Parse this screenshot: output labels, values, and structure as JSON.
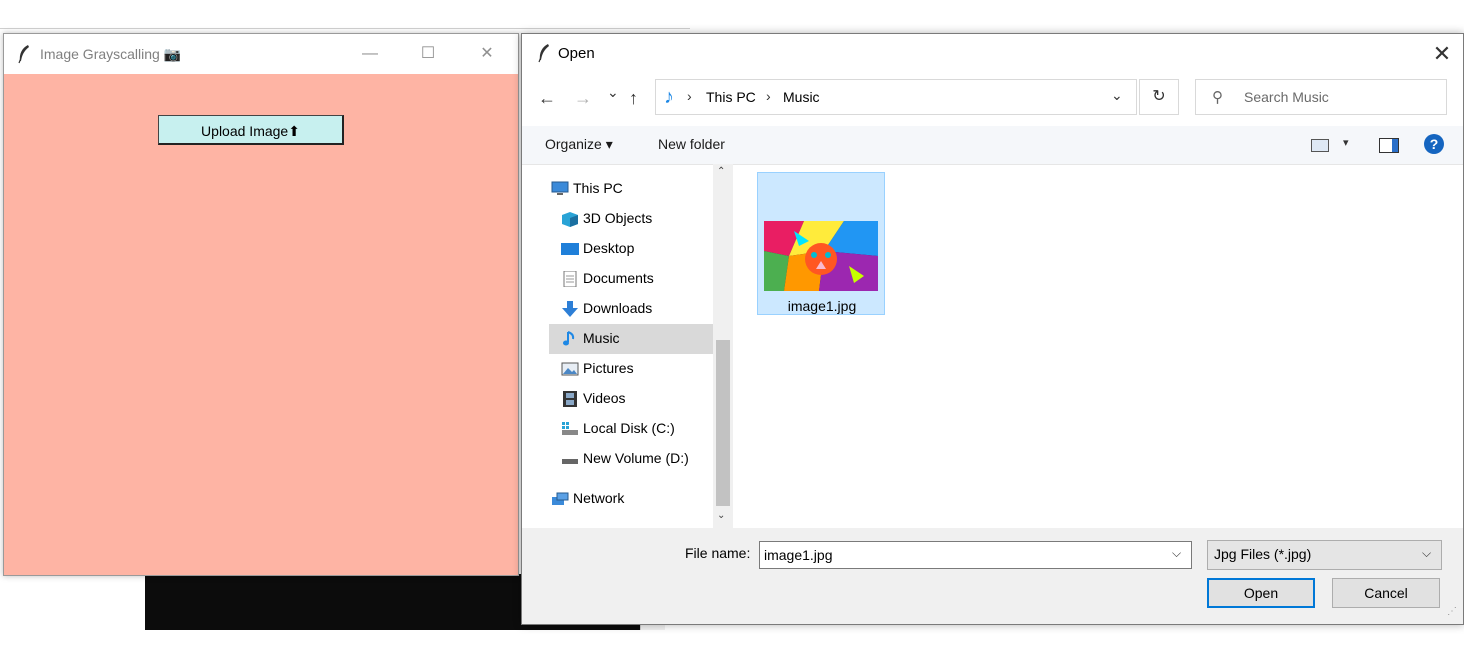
{
  "tk_window": {
    "title": "Image Grayscalling 📷",
    "icon": "tk-feather-icon",
    "controls": {
      "minimize": "—",
      "maximize": "☐",
      "close": "✕"
    },
    "upload_button": "Upload Image⬆",
    "background_color": "#feb4a4",
    "button_color": "#c7f0ef"
  },
  "dialog": {
    "title": "Open",
    "close": "✕",
    "nav": {
      "back": "←",
      "forward": "→",
      "recent": "⌄",
      "up": "↑"
    },
    "breadcrumb": [
      "This PC",
      "Music"
    ],
    "breadcrumb_sep": "›",
    "address_dropdown": "⌄",
    "refresh": "↻",
    "search": {
      "placeholder": "Search Music",
      "icon": "search-icon"
    },
    "toolbar": {
      "organize": "Organize ▾",
      "new_folder": "New folder",
      "view_dropdown": "▾",
      "help": "?"
    },
    "nav_pane": [
      {
        "label": "This PC",
        "icon": "computer-icon"
      },
      {
        "label": "3D Objects",
        "icon": "cube-icon"
      },
      {
        "label": "Desktop",
        "icon": "desktop-icon"
      },
      {
        "label": "Documents",
        "icon": "document-icon"
      },
      {
        "label": "Downloads",
        "icon": "download-arrow-icon"
      },
      {
        "label": "Music",
        "icon": "music-note-icon",
        "selected": true
      },
      {
        "label": "Pictures",
        "icon": "picture-icon"
      },
      {
        "label": "Videos",
        "icon": "film-icon"
      },
      {
        "label": "Local Disk (C:)",
        "icon": "drive-icon"
      },
      {
        "label": "New Volume (D:)",
        "icon": "drive-icon"
      },
      {
        "label": "Network",
        "icon": "network-icon"
      }
    ],
    "scroll": {
      "up": "⌃",
      "down": "⌄"
    },
    "files": [
      {
        "name": "image1.jpg",
        "selected": true
      }
    ],
    "file_name_label": "File name:",
    "file_name_value": "image1.jpg",
    "file_name_dropdown": "⌵",
    "file_type": "Jpg Files (*.jpg)",
    "file_type_dropdown": "⌵",
    "open_button": "Open",
    "cancel_button": "Cancel",
    "accent_color": "#0078d7"
  }
}
